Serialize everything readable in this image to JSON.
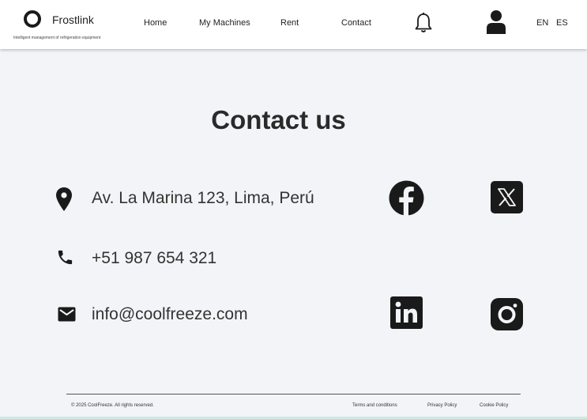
{
  "header": {
    "brand": "Frostlink",
    "tagline": "Intelligent management of refrigeration equipment",
    "nav": [
      {
        "label": "Home"
      },
      {
        "label": "My Machines"
      },
      {
        "label": "Rent"
      },
      {
        "label": "Contact"
      }
    ],
    "icons": [
      "bell-icon",
      "user-icon"
    ],
    "languages": [
      "EN",
      "ES"
    ]
  },
  "main": {
    "title": "Contact us",
    "contact": {
      "address": "Av. La Marina 123,  Lima, Perú",
      "phone": "+51 987 654 321",
      "email": "info@coolfreeze.com"
    },
    "social": [
      "facebook-icon",
      "x-icon",
      "linkedin-icon",
      "instagram-icon"
    ]
  },
  "footer": {
    "copyright": "© 2025 CoolFreeze. All rights reserved.",
    "links": [
      "Terms and conditions",
      "Privacy Policy",
      "Cookie Policy"
    ]
  },
  "colors": {
    "background": "#f2f4f7",
    "header": "#ffffff",
    "icon": "#1a1a1a",
    "text": "#2a2a2a"
  }
}
